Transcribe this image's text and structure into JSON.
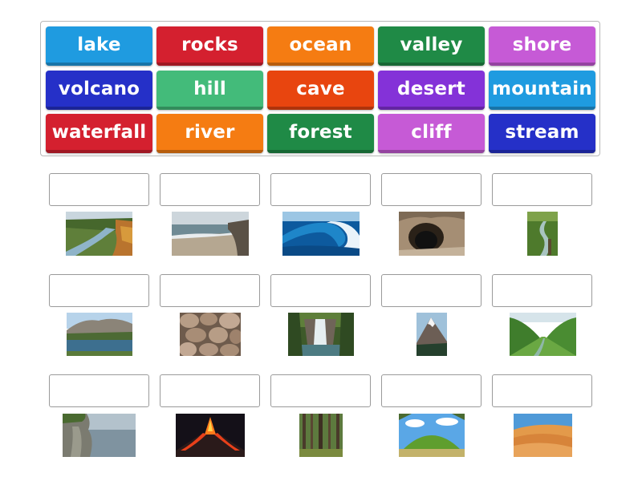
{
  "word_bank": [
    {
      "label": "lake",
      "color": "#1f9be0"
    },
    {
      "label": "rocks",
      "color": "#d4202f"
    },
    {
      "label": "ocean",
      "color": "#f57c12"
    },
    {
      "label": "valley",
      "color": "#1f8a46"
    },
    {
      "label": "shore",
      "color": "#c65ad6"
    },
    {
      "label": "volcano",
      "color": "#2530c8"
    },
    {
      "label": "hill",
      "color": "#43bb7a"
    },
    {
      "label": "cave",
      "color": "#e8450f"
    },
    {
      "label": "desert",
      "color": "#8432d8"
    },
    {
      "label": "mountain",
      "color": "#1f9be0"
    },
    {
      "label": "waterfall",
      "color": "#d4202f"
    },
    {
      "label": "river",
      "color": "#f57c12"
    },
    {
      "label": "forest",
      "color": "#1f8a46"
    },
    {
      "label": "cliff",
      "color": "#c65ad6"
    },
    {
      "label": "stream",
      "color": "#2530c8"
    }
  ],
  "slots": [
    {
      "picture": "river-photo"
    },
    {
      "picture": "shore-photo"
    },
    {
      "picture": "ocean-wave-photo"
    },
    {
      "picture": "cave-photo"
    },
    {
      "picture": "stream-photo"
    },
    {
      "picture": "lake-photo"
    },
    {
      "picture": "rocks-photo"
    },
    {
      "picture": "waterfall-photo"
    },
    {
      "picture": "mountain-photo"
    },
    {
      "picture": "valley-photo"
    },
    {
      "picture": "cliff-photo"
    },
    {
      "picture": "volcano-photo"
    },
    {
      "picture": "forest-photo"
    },
    {
      "picture": "hill-photo"
    },
    {
      "picture": "desert-photo"
    }
  ]
}
